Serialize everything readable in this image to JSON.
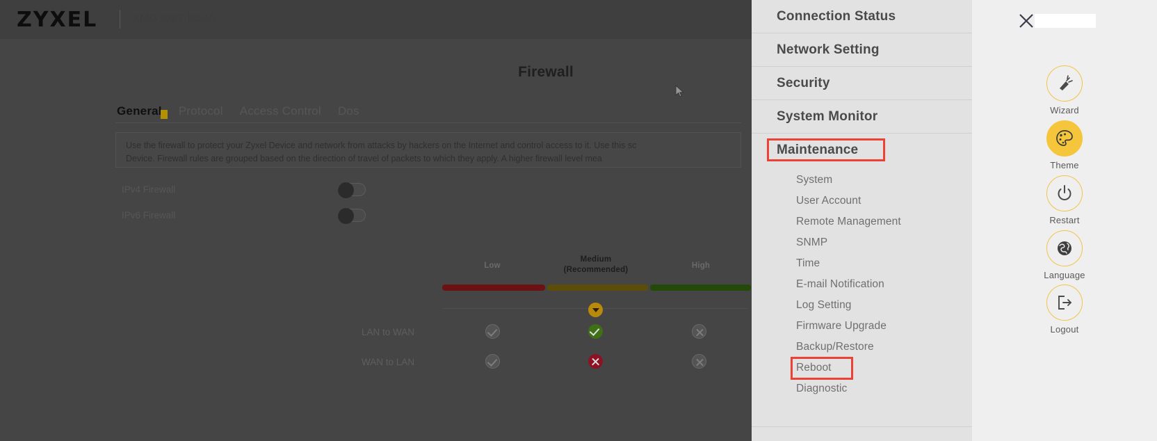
{
  "header": {
    "logo": "ZYXEL",
    "model": "XMG3927-B50A"
  },
  "page": {
    "title": "Firewall",
    "tabs": [
      {
        "label": "General",
        "active": true
      },
      {
        "label": "Protocol",
        "active": false
      },
      {
        "label": "Access Control",
        "active": false
      },
      {
        "label": "Dos",
        "active": false
      }
    ],
    "info_line_1": "Use the firewall to protect your Zyxel Device and network from attacks by hackers on the Internet and control access to it. Use this sc",
    "info_line_2": "Device. Firewall rules are grouped based on the direction of travel of packets to which they apply. A higher firewall level mea",
    "toggles": [
      {
        "label": "IPv4 Firewall",
        "state": "off"
      },
      {
        "label": "IPv6 Firewall",
        "state": "off"
      }
    ],
    "levels": [
      {
        "label": "Low",
        "sublabel": "",
        "selected": false,
        "color": "#6d1212"
      },
      {
        "label": "Medium",
        "sublabel": "(Recommended)",
        "selected": true,
        "color": "#5c4e08"
      },
      {
        "label": "High",
        "sublabel": "",
        "selected": false,
        "color": "#234a08"
      }
    ],
    "matrix_rows": [
      {
        "label": "LAN to WAN",
        "cells": [
          "check-gray",
          "check-green",
          "cross-gray"
        ]
      },
      {
        "label": "WAN to LAN",
        "cells": [
          "check-gray",
          "cross-red",
          "cross-gray"
        ]
      }
    ]
  },
  "menu": {
    "main_items": [
      {
        "label": "Connection Status",
        "highlighted": false
      },
      {
        "label": "Network Setting",
        "highlighted": false
      },
      {
        "label": "Security",
        "highlighted": false
      },
      {
        "label": "System Monitor",
        "highlighted": false
      },
      {
        "label": "Maintenance",
        "highlighted": true
      }
    ],
    "sub_items": [
      {
        "label": "System",
        "highlighted": false
      },
      {
        "label": "User Account",
        "highlighted": false
      },
      {
        "label": "Remote Management",
        "highlighted": false
      },
      {
        "label": "SNMP",
        "highlighted": false
      },
      {
        "label": "Time",
        "highlighted": false
      },
      {
        "label": "E-mail Notification",
        "highlighted": false
      },
      {
        "label": "Log Setting",
        "highlighted": false
      },
      {
        "label": "Firmware Upgrade",
        "highlighted": false
      },
      {
        "label": "Backup/Restore",
        "highlighted": false
      },
      {
        "label": "Reboot",
        "highlighted": true
      },
      {
        "label": "Diagnostic",
        "highlighted": false
      }
    ],
    "highlight_color": "#ee4136"
  },
  "rail": {
    "close_icon": "close-icon",
    "items": [
      {
        "label": "Wizard",
        "icon": "wizard-flashlight-icon",
        "filled": false
      },
      {
        "label": "Theme",
        "icon": "theme-palette-icon",
        "filled": true
      },
      {
        "label": "Restart",
        "icon": "power-icon",
        "filled": false
      },
      {
        "label": "Language",
        "icon": "globe-icon",
        "filled": false
      },
      {
        "label": "Logout",
        "icon": "logout-icon",
        "filled": false
      }
    ],
    "accent_color": "#f5c53c"
  }
}
